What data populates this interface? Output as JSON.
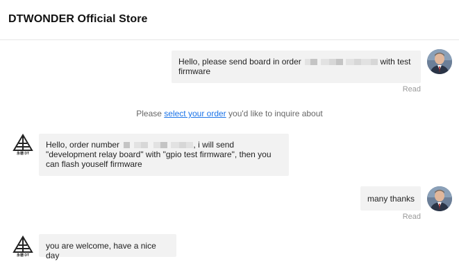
{
  "header": {
    "title": "DTWONDER Official Store"
  },
  "messages": [
    {
      "from": "user",
      "text_before": "Hello, please send board in order",
      "text_after": "with test firmware",
      "status": "Read"
    },
    {
      "from": "store",
      "text_before": "Hello, order number",
      "text_after": "i will send \"development relay board\" with \"gpio test firmware\", then you can flash youself firmware"
    },
    {
      "from": "user",
      "text": "many thanks",
      "status": "Read"
    },
    {
      "from": "store",
      "text": "you are welcome, have a nice day"
    }
  ],
  "system_notice": {
    "prefix": "Please",
    "link_text": "select your order",
    "suffix": "you'd like to inquire about"
  },
  "store_logo_text": "永德 DT",
  "colors": {
    "link": "#1a73e8",
    "bubble": "#f2f2f2",
    "read": "#9a9a9a"
  }
}
